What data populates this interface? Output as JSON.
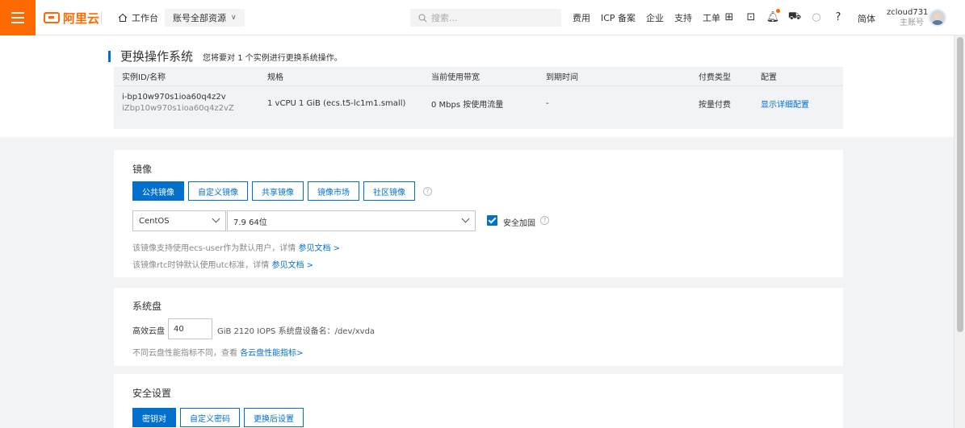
{
  "topbar": {
    "logo_text": "阿里云",
    "workbench": "工作台",
    "resource_scope": "账号全部资源",
    "search_placeholder": "搜索...",
    "nav": [
      "费用",
      "ICP 备案",
      "企业",
      "支持",
      "工单"
    ],
    "lang": "简体",
    "user_name": "zcloud731",
    "user_role": "主账号"
  },
  "page": {
    "title": "更换操作系统",
    "description": "您将要对 1 个实例进行更换系统操作。"
  },
  "instance_table": {
    "headers": [
      "实例ID/名称",
      "规格",
      "当前使用带宽",
      "到期时间",
      "付费类型",
      "配置"
    ],
    "row": {
      "id": "i-bp10w970s1ioa60q4z2v",
      "name": "iZbp10w970s1ioa60q4z2vZ",
      "spec": "1 vCPU 1 GiB  (ecs.t5-lc1m1.small)",
      "bandwidth": "0 Mbps 按使用流量",
      "expire": "-",
      "billing": "按量付费",
      "config_link": "显示详细配置"
    }
  },
  "image_section": {
    "title": "镜像",
    "tabs": [
      "公共镜像",
      "自定义镜像",
      "共享镜像",
      "镜像市场",
      "社区镜像"
    ],
    "active_tab": 0,
    "os": "CentOS",
    "version": "7.9 64位",
    "security_label": "安全加固",
    "security_checked": true,
    "note1_text": "该镜像支持使用ecs-user作为默认用户，详情",
    "note1_link": "参见文档 >",
    "note2_text": "该镜像rtc时钟默认使用utc标准，详情",
    "note2_link": "参见文档 >"
  },
  "disk_section": {
    "title": "系统盘",
    "disk_type": "高效云盘",
    "size": "40",
    "info": "GiB  2120 IOPS  系统盘设备名：/dev/xvda",
    "note_text": "不同云盘性能指标不同，查看",
    "note_link": "各云盘性能指标>"
  },
  "security_section": {
    "title": "安全设置",
    "tabs": [
      "密钥对",
      "自定义密码",
      "更换后设置"
    ],
    "active_tab": 0
  },
  "colors": {
    "accent": "#ff6a00",
    "primary": "#0070cc"
  }
}
